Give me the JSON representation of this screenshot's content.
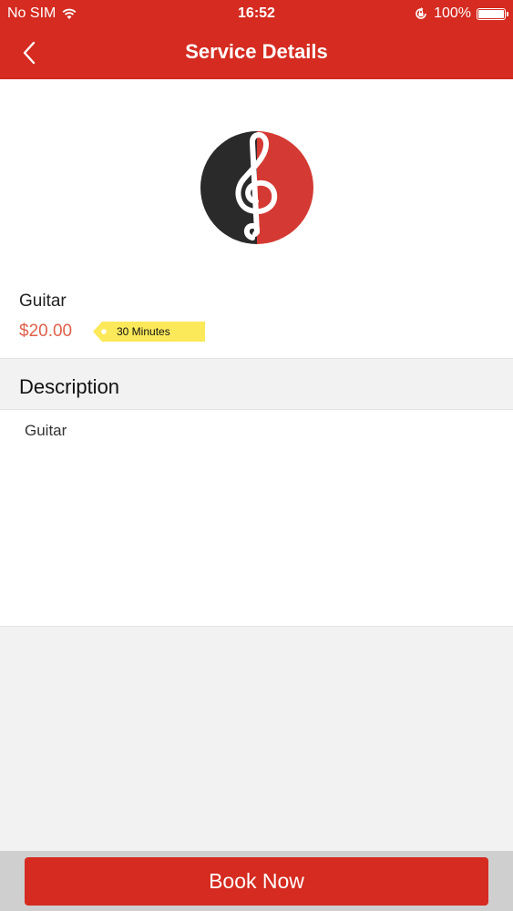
{
  "status_bar": {
    "carrier": "No SIM",
    "time": "16:52",
    "battery": "100%",
    "icons": [
      "wifi-icon",
      "orientation-lock-icon",
      "battery-icon"
    ]
  },
  "navbar": {
    "title": "Service Details",
    "back_icon": "chevron-left-icon"
  },
  "service": {
    "logo_icon": "treble-clef-icon",
    "name": "Guitar",
    "price": "$20.00",
    "duration": "30 Minutes"
  },
  "description": {
    "header": "Description",
    "text": "Guitar"
  },
  "actions": {
    "book_label": "Book Now"
  },
  "colors": {
    "primary": "#d52b20",
    "price": "#e0604a",
    "tag": "#fbe95a"
  }
}
